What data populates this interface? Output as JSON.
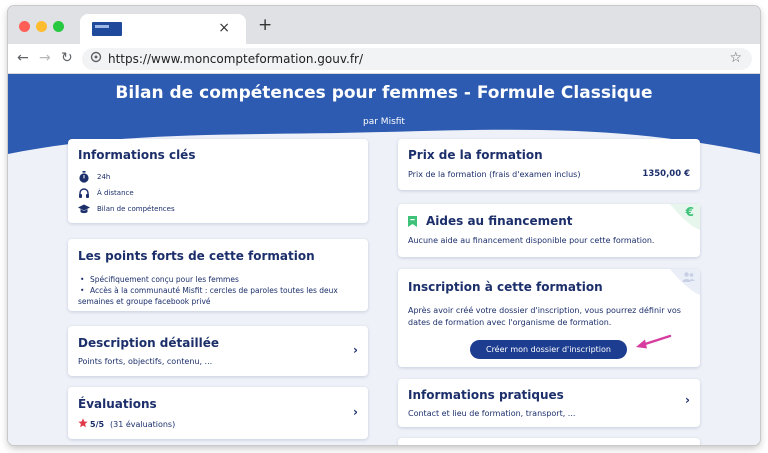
{
  "browser": {
    "tab_close": "×",
    "new_tab": "+",
    "url": "https://www.moncompteformation.gouv.fr/",
    "icons": {
      "back": "arrow-left-icon",
      "forward": "arrow-right-icon",
      "reload": "reload-icon",
      "site_info": "site-info-icon",
      "bookmark": "star-icon"
    }
  },
  "header": {
    "title": "Bilan de compétences pour femmes - Formule Classique",
    "subtitle": "par Misfit",
    "background": "#2d5bb1"
  },
  "left": {
    "key_info": {
      "title": "Informations clés",
      "rows": [
        {
          "icon": "stopwatch-icon",
          "label": "24h"
        },
        {
          "icon": "headphones-icon",
          "label": "À distance"
        },
        {
          "icon": "graduation-cap-icon",
          "label": "Bilan de compétences"
        }
      ]
    },
    "strengths": {
      "title": "Les points forts de cette formation",
      "items": [
        "Spécifiquement conçu pour les femmes",
        "Accès à la communauté Misfit : cercles de paroles toutes les deux"
      ],
      "continuation": "semaines et groupe facebook privé"
    },
    "description": {
      "title": "Description détaillée",
      "text": "Points forts, objectifs, contenu, ..."
    },
    "reviews": {
      "title": "Évaluations",
      "score": "5/5",
      "count": "(31 évaluations)"
    }
  },
  "right": {
    "price": {
      "title": "Prix de la formation",
      "label": "Prix de la formation (frais d'examen inclus)",
      "value": "1350,00 €"
    },
    "aid": {
      "title": "Aides au financement",
      "text": "Aucune aide au financement disponible pour cette formation.",
      "corner": "€"
    },
    "signup": {
      "title": "Inscription à cette formation",
      "text_line1": "Après avoir créé votre dossier d'inscription, vous pourrez définir vos",
      "text_line2": "dates de formation avec l'organisme de formation.",
      "button": "Créer mon dossier d'inscription"
    },
    "practical": {
      "title": "Informations pratiques",
      "text": "Contact et lieu de formation, transport, ..."
    }
  },
  "colors": {
    "primary": "#1d3d91",
    "text": "#1c2f6b",
    "euro_green": "#3ec27a",
    "annotation_arrow": "#d63d9f"
  }
}
